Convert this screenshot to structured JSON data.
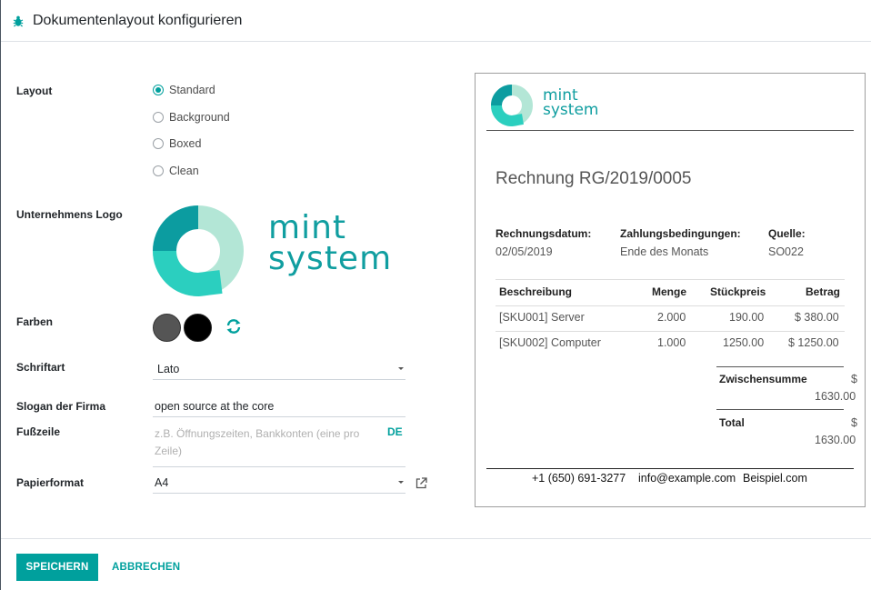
{
  "dialog": {
    "title": "Dokumentenlayout konfigurieren"
  },
  "form": {
    "layout_label": "Layout",
    "layout_options": [
      {
        "label": "Standard",
        "checked": true
      },
      {
        "label": "Background",
        "checked": false
      },
      {
        "label": "Boxed",
        "checked": false
      },
      {
        "label": "Clean",
        "checked": false
      }
    ],
    "logo_label": "Unternehmens Logo",
    "logo_text_line1": "mint",
    "logo_text_line2": "system",
    "colors_label": "Farben",
    "colors": {
      "primary": "#555555",
      "secondary": "#000000",
      "accent": "#00a09d"
    },
    "font_label": "Schriftart",
    "font_value": "Lato",
    "slogan_label": "Slogan der Firma",
    "slogan_value": "open source at the core",
    "footer_label": "Fußzeile",
    "footer_placeholder": "z.B. Öffnungszeiten, Bankkonten (eine pro Zeile)",
    "footer_lang": "DE",
    "paper_label": "Papierformat",
    "paper_value": "A4"
  },
  "preview": {
    "logo_line1": "mint",
    "logo_line2": "system",
    "invoice_title": "Rechnung RG/2019/0005",
    "meta": [
      {
        "label": "Rechnungsdatum:",
        "value": "02/05/2019"
      },
      {
        "label": "Zahlungsbedingungen:",
        "value": "Ende des Monats"
      },
      {
        "label": "Quelle:",
        "value": "SO022"
      }
    ],
    "table_headers": [
      "Beschreibung",
      "Menge",
      "Stückpreis",
      "Betrag"
    ],
    "rows": [
      [
        "[SKU001] Server",
        "2.000",
        "190.00",
        "$ 380.00"
      ],
      [
        "[SKU002] Computer",
        "1.000",
        "1250.00",
        "$ 1250.00"
      ]
    ],
    "subtotal_label": "Zwischensumme",
    "subtotal_currency": "$",
    "subtotal_value": "1630.00",
    "total_label": "Total",
    "total_currency": "$",
    "total_value": "1630.00",
    "footer_phone": "+1 (650) 691-3277",
    "footer_email": "info@example.com",
    "footer_company": "Beispiel.com"
  },
  "actions": {
    "save": "SPEICHERN",
    "cancel": "ABBRECHEN"
  }
}
